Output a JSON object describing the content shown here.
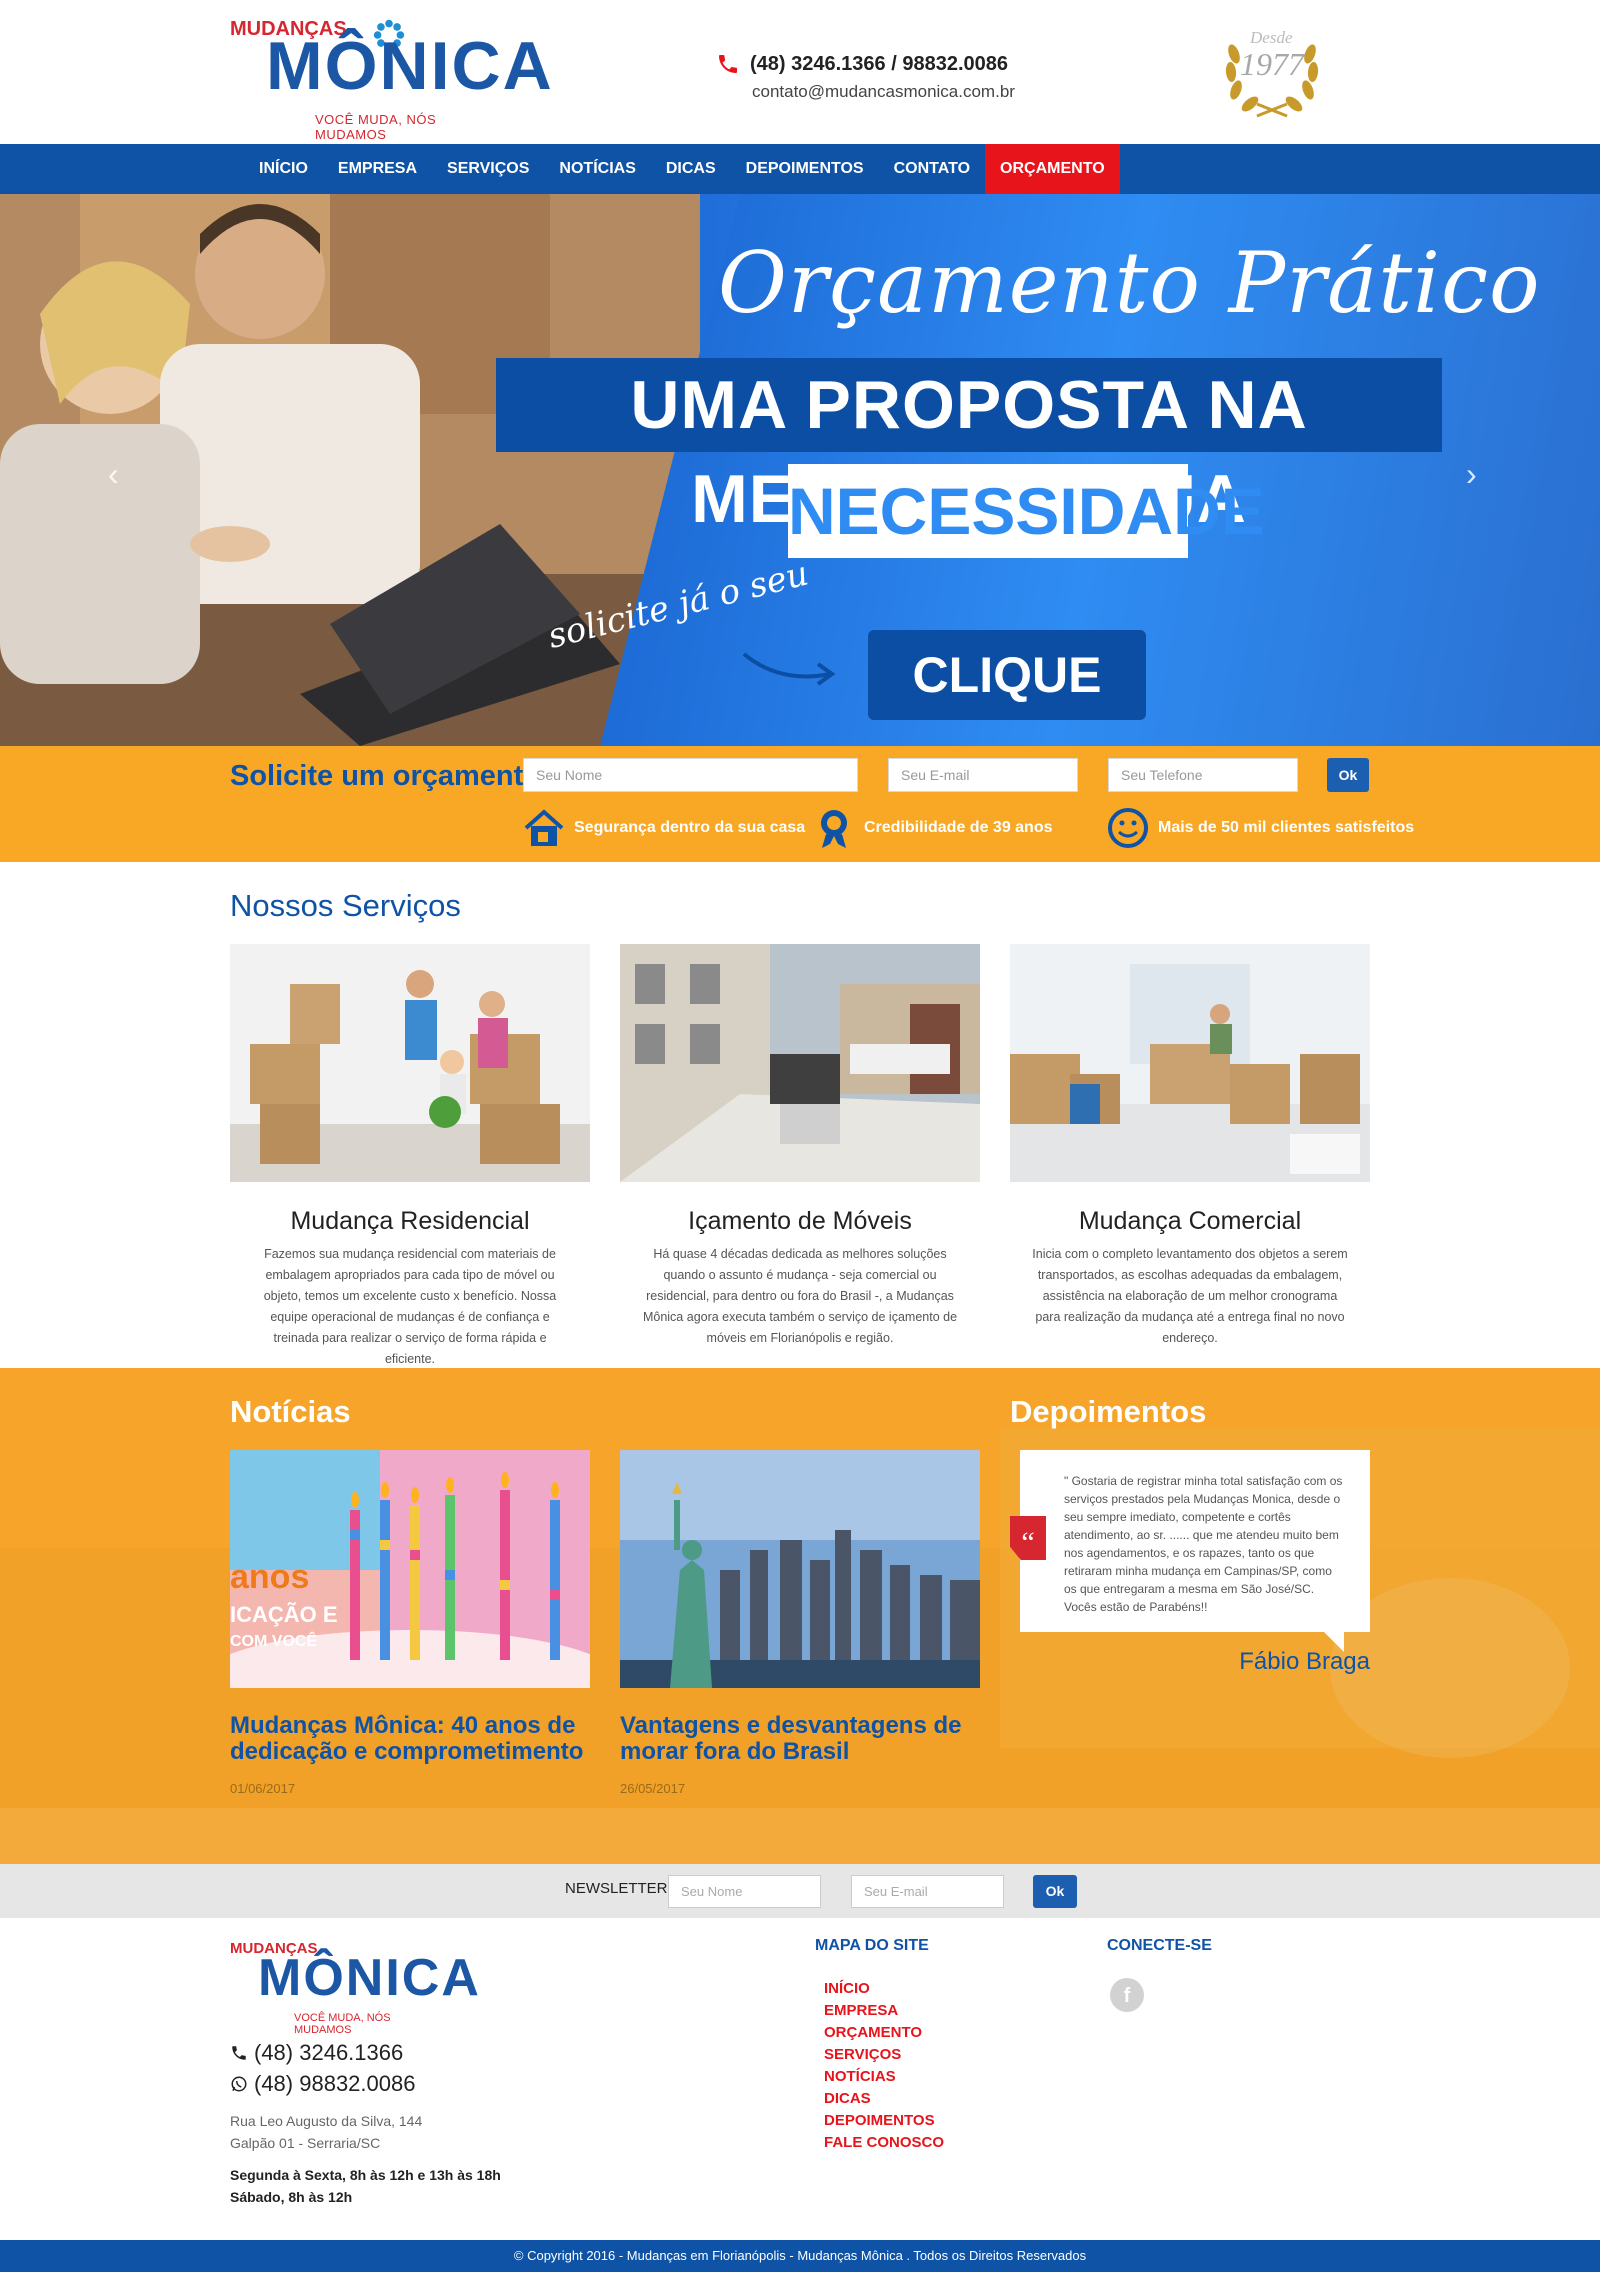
{
  "header": {
    "logo_top": "MUDANÇAS",
    "logo_main": "MÔNICA",
    "logo_tagline": "VOCÊ MUDA, NÓS MUDAMOS",
    "phone": "(48) 3246.1366 / 98832.0086",
    "email": "contato@mudancasmonica.com.br",
    "seal_desde": "Desde",
    "seal_year": "1977"
  },
  "nav": {
    "items": [
      "INÍCIO",
      "EMPRESA",
      "SERVIÇOS",
      "NOTÍCIAS",
      "DICAS",
      "DEPOIMENTOS",
      "CONTATO",
      "ORÇAMENTO"
    ],
    "active": "ORÇAMENTO"
  },
  "hero": {
    "script_title": "Orçamento Prático",
    "line1": "UMA PROPOSTA NA MEDIDA DA SUA",
    "line2": "NECESSIDADE",
    "solicite": "solicite já o seu",
    "cta": "CLIQUE AQUI"
  },
  "quote": {
    "title": "Solicite um orçamento",
    "name_placeholder": "Seu Nome",
    "email_placeholder": "Seu E-mail",
    "phone_placeholder": "Seu Telefone",
    "button": "Ok",
    "features": [
      "Segurança dentro da sua casa",
      "Credibilidade de 39 anos",
      "Mais de 50 mil clientes satisfeitos"
    ]
  },
  "services": {
    "title": "Nossos Serviços",
    "items": [
      {
        "name": "Mudança Residencial",
        "desc": "Fazemos sua mudança residencial com materiais de embalagem apropriados para cada tipo de móvel ou objeto, temos um excelente custo x benefício. Nossa equipe operacional de mudanças é de confiança e treinada para realizar o serviço de forma rápida e eficiente."
      },
      {
        "name": "Içamento de Móveis",
        "desc": "Há quase 4 décadas dedicada as melhores soluções quando o assunto é mudança - seja comercial ou residencial, para dentro ou fora do Brasil -, a Mudanças Mônica agora executa também o serviço de içamento de móveis em Florianópolis e região."
      },
      {
        "name": "Mudança Comercial",
        "desc": "Inicia com o completo levantamento dos objetos a serem transportados, as escolhas adequadas da embalagem, assistência na elaboração de um melhor cronograma para realização da mudança até a entrega final no novo endereço."
      }
    ]
  },
  "news": {
    "title": "Notícias",
    "items": [
      {
        "title": "Mudanças Mônica: 40 anos de dedicação e comprometimento",
        "date": "01/06/2017",
        "img_text1": "anos",
        "img_text2": "ICAÇÃO E",
        "img_text3": "COM VOCÊ"
      },
      {
        "title": "Vantagens e desvantagens de morar fora do Brasil",
        "date": "26/05/2017"
      }
    ]
  },
  "testimonials": {
    "title": "Depoimentos",
    "quote": "\" Gostaria de registrar minha total satisfação com os serviços prestados pela Mudanças Monica, desde o seu sempre imediato, competente e cortês atendimento, ao sr. ...... que me atendeu muito bem nos agendamentos, e os rapazes, tanto os que retiraram minha mudança em Campinas/SP, como os que entregaram a mesma em São José/SC. Vocês estão de Parabéns!!",
    "author": "Fábio Braga",
    "quote_mark": "“"
  },
  "newsletter": {
    "label": "NEWSLETTER",
    "name_placeholder": "Seu Nome",
    "email_placeholder": "Seu E-mail",
    "button": "Ok"
  },
  "footer": {
    "phone1": "(48) 3246.1366",
    "phone2": "(48) 98832.0086",
    "address1": "Rua Leo Augusto da Silva, 144",
    "address2": "Galpão 01 - Serraria/SC",
    "hours1": "Segunda à Sexta, 8h às 12h e 13h às 18h",
    "hours2": "Sábado, 8h às 12h",
    "sitemap_title": "MAPA DO SITE",
    "sitemap": [
      "INÍCIO",
      "EMPRESA",
      "ORÇAMENTO",
      "SERVIÇOS",
      "NOTÍCIAS",
      "DICAS",
      "DEPOIMENTOS",
      "FALE CONOSCO"
    ],
    "connect_title": "CONECTE-SE",
    "facebook": "f",
    "copyright": "© Copyright 2016 - Mudanças em Florianópolis - Mudanças Mônica . Todos os Direitos Reservados"
  },
  "colors": {
    "brand_blue": "#0e53a6",
    "brand_red": "#e8141b",
    "brand_orange": "#f9a826"
  }
}
